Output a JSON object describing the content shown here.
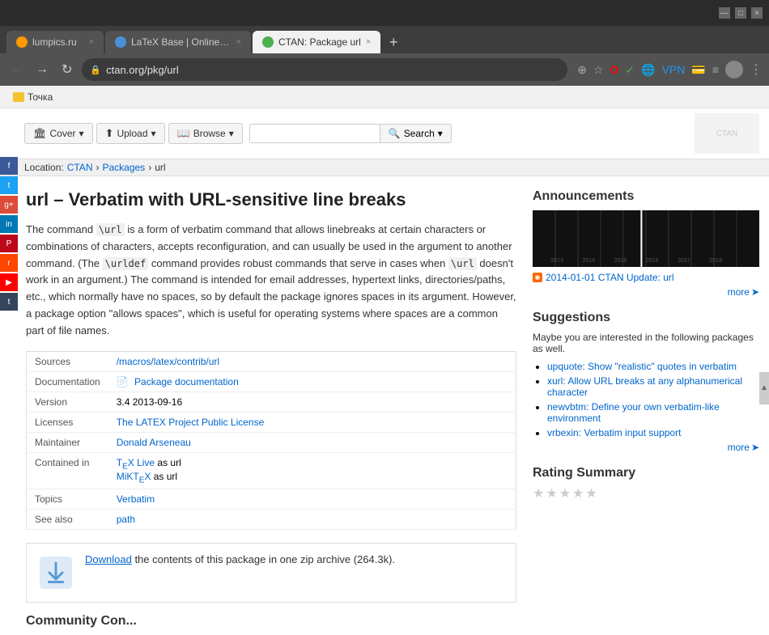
{
  "browser": {
    "tabs": [
      {
        "id": "tab1",
        "title": "lumpics.ru",
        "favicon_color": "#f90",
        "active": false
      },
      {
        "id": "tab2",
        "title": "LaTeX Base | Online LaTeX Editor...",
        "favicon_color": "#4a90d9",
        "active": false
      },
      {
        "id": "tab3",
        "title": "CTAN: Package url",
        "favicon_color": "#4caf50",
        "active": true
      }
    ],
    "new_tab_label": "+",
    "address": "ctan.org/pkg/url",
    "window_controls": [
      "—",
      "□",
      "×"
    ]
  },
  "bookmark_bar": {
    "items": [
      {
        "label": "Точка",
        "type": "folder"
      }
    ]
  },
  "ctan": {
    "nav": {
      "cover_label": "Cover",
      "upload_label": "Upload",
      "browse_label": "Browse",
      "search_label": "Search",
      "search_placeholder": ""
    },
    "breadcrumb": {
      "location_label": "Location:",
      "items": [
        "CTAN",
        "Packages",
        "url"
      ]
    },
    "page": {
      "title": "url – Verbatim with URL-sensitive line breaks",
      "description1": "The command \\url is a form of verbatim command that allows linebreaks at certain characters or combinations of characters, accepts reconfiguration, and can usually be used in the argument to another command. (The \\urldef command provides robust commands that serve in cases when \\url doesn't work in an argument.) The command is intended for email addresses, hypertext links, directories/paths, etc., which normally have no spaces, so by default the package ignores spaces in its argument. However, a package option \"allows spaces\", which is useful for operating systems where spaces are a common part of file names.",
      "info_table": {
        "rows": [
          {
            "label": "Sources",
            "value": "/macros/latex/contrib/url",
            "link": true
          },
          {
            "label": "Documentation",
            "value": "Package documentation",
            "link": true,
            "has_icon": true
          },
          {
            "label": "Version",
            "value": "3.4 2013-09-16",
            "link": false
          },
          {
            "label": "Licenses",
            "value": "The LATEX Project Public License",
            "link": true
          },
          {
            "label": "Maintainer",
            "value": "Donald Arseneau",
            "link": true
          },
          {
            "label": "Contained in",
            "value1": "TeX Live as url",
            "value2": "MiKTeX as url",
            "link": true
          },
          {
            "label": "Topics",
            "value": "Verbatim",
            "link": true
          },
          {
            "label": "See also",
            "value": "path",
            "link": true
          }
        ]
      },
      "download": {
        "text_before": "Download",
        "text_link": "Download",
        "text_after": "the contents of this package in one zip archive (264.3k)."
      }
    },
    "sidebar": {
      "announcements_title": "Announcements",
      "announcement_link": "2014-01-01 CTAN Update: url",
      "more_label": "more",
      "suggestions_title": "Suggestions",
      "suggestions_intro": "Maybe you are interested in the following packages as well.",
      "suggestions": [
        {
          "text": "upquote: Show \"realistic\" quotes in verbatim",
          "link": "#"
        },
        {
          "text": "xurl: Allow URL breaks at any alphanumerical character",
          "link": "#"
        },
        {
          "text": "newvbtm: Define your own verbatim-like environment",
          "link": "#"
        },
        {
          "text": "vrbexin: Verbatim input support",
          "link": "#"
        }
      ],
      "rating_title": "Rating Summary"
    }
  }
}
